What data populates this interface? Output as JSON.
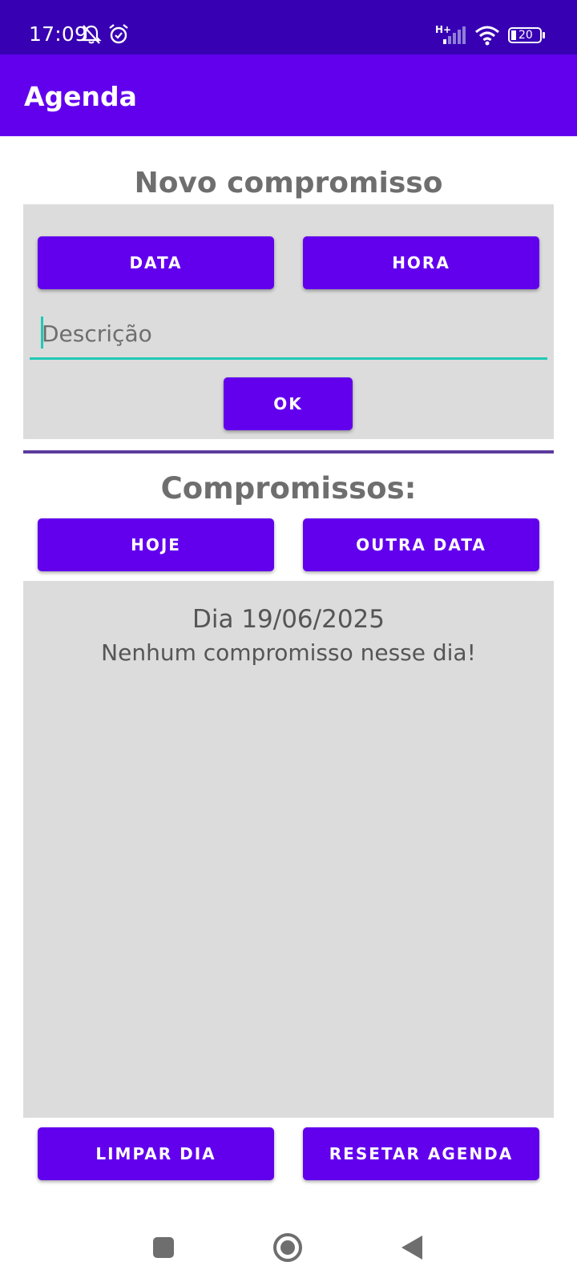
{
  "status_bar": {
    "time": "17:09",
    "network_label": "H+",
    "battery_level": "20",
    "icons": [
      "bell-off-icon",
      "alarm-icon",
      "signal-icon",
      "wifi-icon",
      "battery-icon"
    ]
  },
  "app_bar": {
    "title": "Agenda"
  },
  "new_appointment": {
    "heading": "Novo compromisso",
    "date_button": "DATA",
    "time_button": "HORA",
    "description_placeholder": "Descrição",
    "description_value": "",
    "ok_button": "OK"
  },
  "appointments": {
    "heading": "Compromissos:",
    "today_button": "HOJE",
    "other_date_button": "OUTRA DATA",
    "list_date": "Dia 19/06/2025",
    "empty_message": "Nenhum compromisso nesse dia!"
  },
  "footer_actions": {
    "clear_day_button": "LIMPAR DIA",
    "reset_button": "RESETAR AGENDA"
  },
  "nav_bar": {
    "icons": [
      "recents-icon",
      "home-icon",
      "back-icon"
    ]
  },
  "colors": {
    "primary": "#6200ee",
    "primary_dark": "#3700b3",
    "panel": "#dcdcdc",
    "accent": "#1fc9b5",
    "divider": "#5c3b9e"
  }
}
